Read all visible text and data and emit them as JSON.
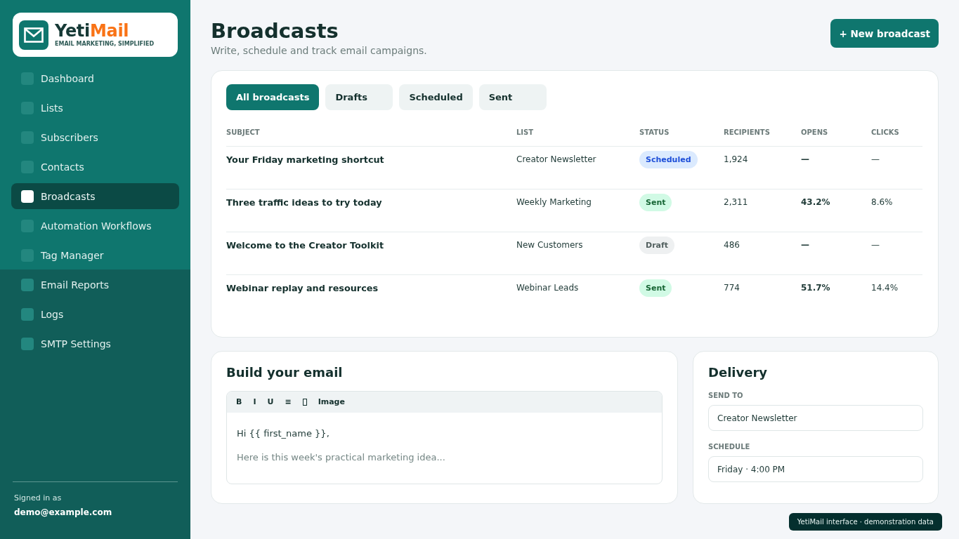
{
  "sidebar": {
    "logo": {
      "name_first": "Yeti",
      "name_second": "Mail",
      "tagline": "EMAIL MARKETING, SIMPLIFIED"
    },
    "sections": [
      {
        "items": [
          {
            "label": "Dashboard",
            "selected": false
          },
          {
            "label": "Lists",
            "selected": false
          },
          {
            "label": "Subscribers",
            "selected": false
          },
          {
            "label": "Contacts",
            "selected": false
          },
          {
            "label": "Broadcasts",
            "selected": true
          },
          {
            "label": "Automation Workflows",
            "selected": false
          },
          {
            "label": "Tag Manager",
            "selected": false
          }
        ]
      },
      {
        "items": [
          {
            "label": "Email Reports",
            "selected": false
          },
          {
            "label": "Logs",
            "selected": false
          },
          {
            "label": "SMTP Settings",
            "selected": false
          }
        ]
      }
    ],
    "account": {
      "label": "Signed in as",
      "email": "demo@example.com"
    }
  },
  "header": {
    "title": "Broadcasts",
    "subtitle": "Write, schedule and track email campaigns.",
    "action": "+ New broadcast"
  },
  "broadcasts": {
    "tabs": [
      {
        "label": "All broadcasts",
        "selected": true
      },
      {
        "label": "Drafts",
        "selected": false
      },
      {
        "label": "Scheduled",
        "selected": false
      },
      {
        "label": "Sent",
        "selected": false
      }
    ],
    "table": {
      "columns": [
        "SUBJECT",
        "LIST",
        "STATUS",
        "RECIPIENTS",
        "OPENS",
        "CLICKS"
      ],
      "rows": [
        {
          "subject": "Your Friday marketing shortcut",
          "list": "Creator Newsletter",
          "status": {
            "label": "Scheduled",
            "kind": "scheduled"
          },
          "recipients": "1,924",
          "opens": "—",
          "clicks": "—"
        },
        {
          "subject": "Three traffic ideas to try today",
          "list": "Weekly Marketing",
          "status": {
            "label": "Sent",
            "kind": "sent"
          },
          "recipients": "2,311",
          "opens": "43.2%",
          "clicks": "8.6%"
        },
        {
          "subject": "Welcome to the Creator Toolkit",
          "list": "New Customers",
          "status": {
            "label": "Draft",
            "kind": "draft"
          },
          "recipients": "486",
          "opens": "—",
          "clicks": "—"
        },
        {
          "subject": "Webinar replay and resources",
          "list": "Webinar Leads",
          "status": {
            "label": "Sent",
            "kind": "sent"
          },
          "recipients": "774",
          "opens": "51.7%",
          "clicks": "14.4%"
        }
      ]
    }
  },
  "editor": {
    "title": "Build your email",
    "toolbar": [
      {
        "kind": "text",
        "label": "B"
      },
      {
        "kind": "text",
        "label": "I"
      },
      {
        "kind": "text",
        "label": "U"
      },
      {
        "kind": "text",
        "label": "≡"
      },
      {
        "kind": "icon"
      },
      {
        "kind": "text",
        "label": "Image"
      }
    ],
    "lines": [
      {
        "text": "Hi {{ first_name }},",
        "muted": false
      },
      {
        "text": "Here is this week's practical marketing idea...",
        "muted": true
      }
    ]
  },
  "delivery": {
    "title": "Delivery",
    "fields": [
      {
        "label": "SEND TO",
        "value": "Creator Newsletter"
      },
      {
        "label": "SCHEDULE",
        "value": "Friday · 4:00 PM"
      }
    ]
  },
  "footer_note": "YetiMail interface · demonstration data"
}
